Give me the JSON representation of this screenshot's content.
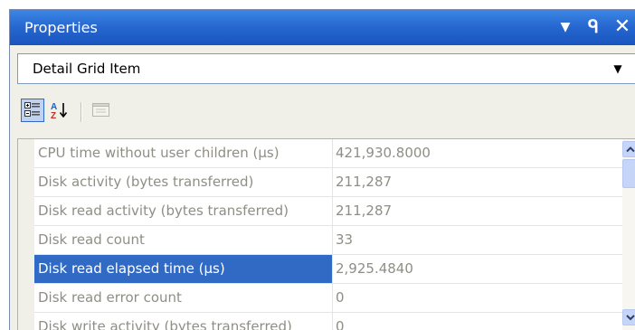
{
  "window": {
    "title": "Properties",
    "controls": {
      "dropdown_icon": "dropdown-arrow-icon",
      "pin_icon": "pin-icon",
      "close_icon": "close-icon",
      "dropdown_glyph": "▼",
      "pin_glyph": "ᑫ",
      "close_glyph": "✕"
    }
  },
  "selector": {
    "value": "Detail Grid Item",
    "arrow_glyph": "▼"
  },
  "toolbar": {
    "buttons": [
      {
        "name": "categorized",
        "icon": "categorized-icon",
        "active": true
      },
      {
        "name": "alphabetical",
        "icon": "sort-az-icon",
        "active": false
      },
      {
        "name": "property-pages",
        "icon": "property-pages-icon",
        "active": false,
        "disabled": true
      }
    ]
  },
  "grid": {
    "rows": [
      {
        "name": "CPU time without user children (μs)",
        "value": "421,930.8000"
      },
      {
        "name": "Disk activity (bytes transferred)",
        "value": "211,287"
      },
      {
        "name": "Disk read activity (bytes transferred)",
        "value": "211,287"
      },
      {
        "name": "Disk read count",
        "value": "33"
      },
      {
        "name": "Disk read elapsed time (μs)",
        "value": "2,925.4840",
        "selected": true
      },
      {
        "name": "Disk read error count",
        "value": "0"
      },
      {
        "name": "Disk write activity (bytes transferred)",
        "value": "0"
      }
    ]
  },
  "colors": {
    "title_bar": "#2566cf",
    "selection": "#316ac5",
    "panel_background": "#f0efe8",
    "readonly_text": "#8f8e86"
  }
}
